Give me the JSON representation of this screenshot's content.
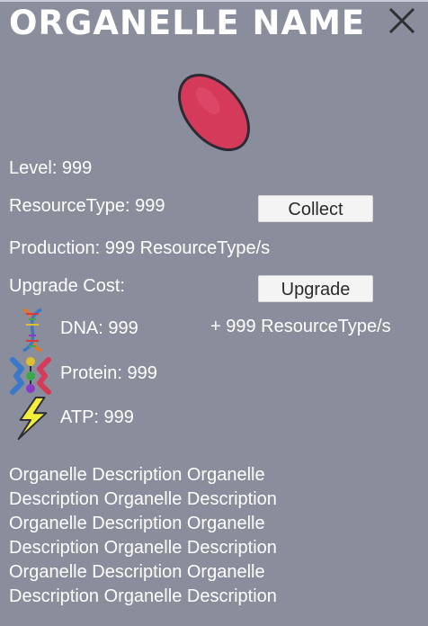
{
  "header": {
    "title": "ORGANELLE NAME",
    "close_label": "X"
  },
  "stats": {
    "level": "Level: 999",
    "resource": "ResourceType: 999",
    "production": "Production: 999 ResourceType/s",
    "upgrade_cost_label": "Upgrade Cost:"
  },
  "buttons": {
    "collect": "Collect",
    "upgrade": "Upgrade"
  },
  "costs": [
    {
      "icon": "dna-icon",
      "text": "DNA: 999"
    },
    {
      "icon": "protein-icon",
      "text": "Protein: 999"
    },
    {
      "icon": "atp-lightning-icon",
      "text": "ATP: 999"
    }
  ],
  "upgrade_bonus": "+ 999 ResourceType/s",
  "description": "Organelle Description Organelle Description Organelle Description Organelle Description Organelle Description Organelle Description Organelle Description Organelle Description Organelle Description",
  "colors": {
    "background": "#8a8e9c",
    "organelle": "#d63a5a",
    "button": "#f4f4f4"
  }
}
